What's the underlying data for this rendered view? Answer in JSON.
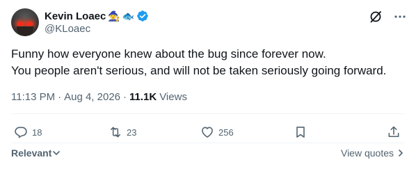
{
  "author": {
    "name": "Kevin Loaec",
    "name_emojis": [
      "🧙",
      "🐟"
    ],
    "handle": "@KLoaec",
    "verified": true,
    "verified_color": "#1d9bf0",
    "avatar_icon": "avatar"
  },
  "header_icons": [
    "grok-icon",
    "more-icon"
  ],
  "tweet": {
    "lines": [
      "Funny how everyone knew about the bug since forever now.",
      "You people aren't serious, and will not be taken seriously going forward."
    ]
  },
  "meta": {
    "time": "11:13 PM",
    "date": "Aug 4, 2026",
    "separator": "·",
    "views_count": "11.1K",
    "views_label": "Views"
  },
  "actions": {
    "replies": "18",
    "reposts": "23",
    "likes": "256"
  },
  "footer": {
    "relevant_label": "Relevant",
    "view_quotes_label": "View quotes"
  },
  "colors": {
    "text_primary": "#0f1419",
    "text_secondary": "#536471",
    "divider": "#eff3f4"
  }
}
